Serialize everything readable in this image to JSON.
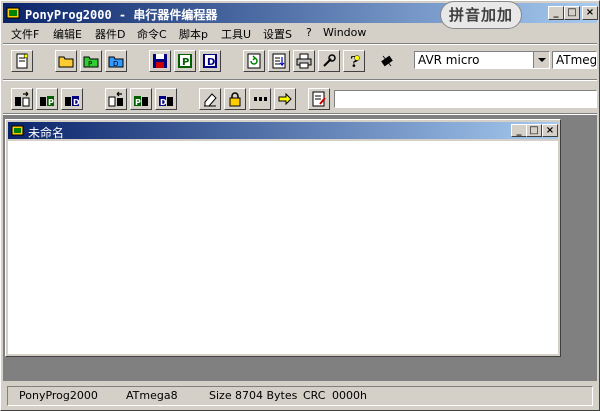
{
  "window": {
    "title": "PonyProg2000 - 串行器件编程器"
  },
  "ime_badge": "拼音加加",
  "menu": [
    "文件F",
    "编辑E",
    "器件D",
    "命令C",
    "脚本p",
    "工具U",
    "设置S",
    "?",
    "Window"
  ],
  "device": {
    "family": "AVR micro",
    "model": "ATmega8"
  },
  "child_window": {
    "title": "未命名"
  },
  "status": {
    "app": "PonyProg2000",
    "device": "ATmega8",
    "size_label": "Size",
    "size_value": "8704 Bytes",
    "crc_label": "CRC",
    "crc_value": "0000h"
  },
  "colors": {
    "title_start": "#0a246a",
    "title_end": "#a6caf0",
    "face": "#d4d0c8",
    "mdi_bg": "#808080"
  }
}
